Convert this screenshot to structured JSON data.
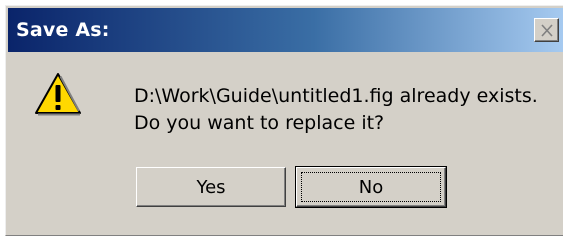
{
  "window": {
    "title": "Save As:",
    "close_icon": "close-icon"
  },
  "dialog": {
    "icon": "warning-icon",
    "message_line1": "D:\\Work\\Guide\\untitled1.fig already exists.",
    "message_line2": "Do you want to replace it?"
  },
  "buttons": {
    "yes_label": "Yes",
    "no_label": "No",
    "default": "No"
  },
  "colors": {
    "titlebar_start": "#0a246a",
    "titlebar_end": "#a6caf0",
    "face": "#d4d0c8",
    "warning_yellow": "#ffd800"
  }
}
